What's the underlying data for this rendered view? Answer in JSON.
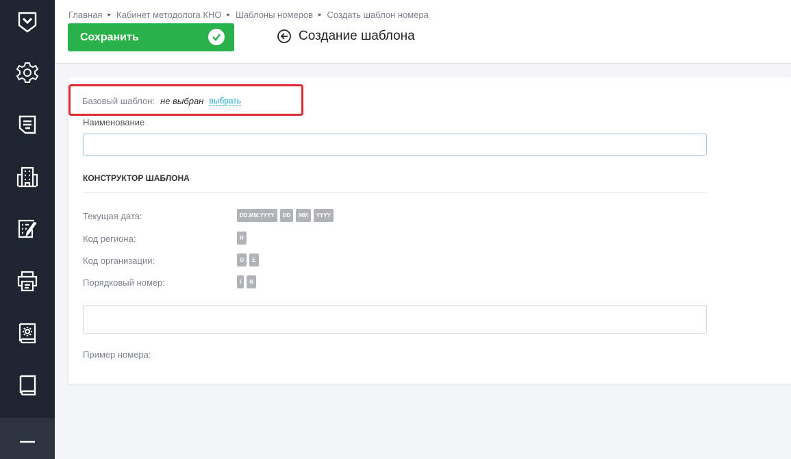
{
  "breadcrumb": [
    "Главная",
    "Кабинет методолога КНО",
    "Шаблоны номеров",
    "Создать шаблон номера"
  ],
  "breadcrumb_separator": "▸",
  "toolbar": {
    "save_label": "Сохранить"
  },
  "page_title": "Создание шаблона",
  "base_template": {
    "label": "Базовый шаблон:",
    "value": "не выбран",
    "link": "выбрать"
  },
  "name_field": {
    "label": "Наименование",
    "value": "",
    "placeholder": ""
  },
  "constructor": {
    "title": "КОНСТРУКТОР ШАБЛОНА",
    "rows": [
      {
        "label": "Текущая дата:",
        "tokens": [
          "DD.MM.YYYY",
          "DD",
          "MM",
          "YYYY"
        ]
      },
      {
        "label": "Код региона:",
        "tokens": [
          "R"
        ]
      },
      {
        "label": "Код организации:",
        "tokens": [
          "O",
          "E"
        ]
      },
      {
        "label": "Порядковый номер:",
        "tokens": [
          "I",
          "N"
        ]
      }
    ]
  },
  "template_field": {
    "value": ""
  },
  "example": {
    "label": "Пример номера:",
    "value": ""
  },
  "sidebar": {
    "items": [
      {
        "icon": "logo-shield-icon"
      },
      {
        "icon": "gear-icon"
      },
      {
        "icon": "document-list-icon"
      },
      {
        "icon": "building-icon"
      },
      {
        "icon": "edit-form-icon"
      },
      {
        "icon": "printer-icon"
      },
      {
        "icon": "settings-book-icon"
      },
      {
        "icon": "book-icon"
      }
    ]
  },
  "colors": {
    "sidebar": "#1e2530",
    "accent": "#2ab24a",
    "link": "#1aa6d8",
    "highlight": "#e0292c",
    "token": "#b0b3b8"
  }
}
